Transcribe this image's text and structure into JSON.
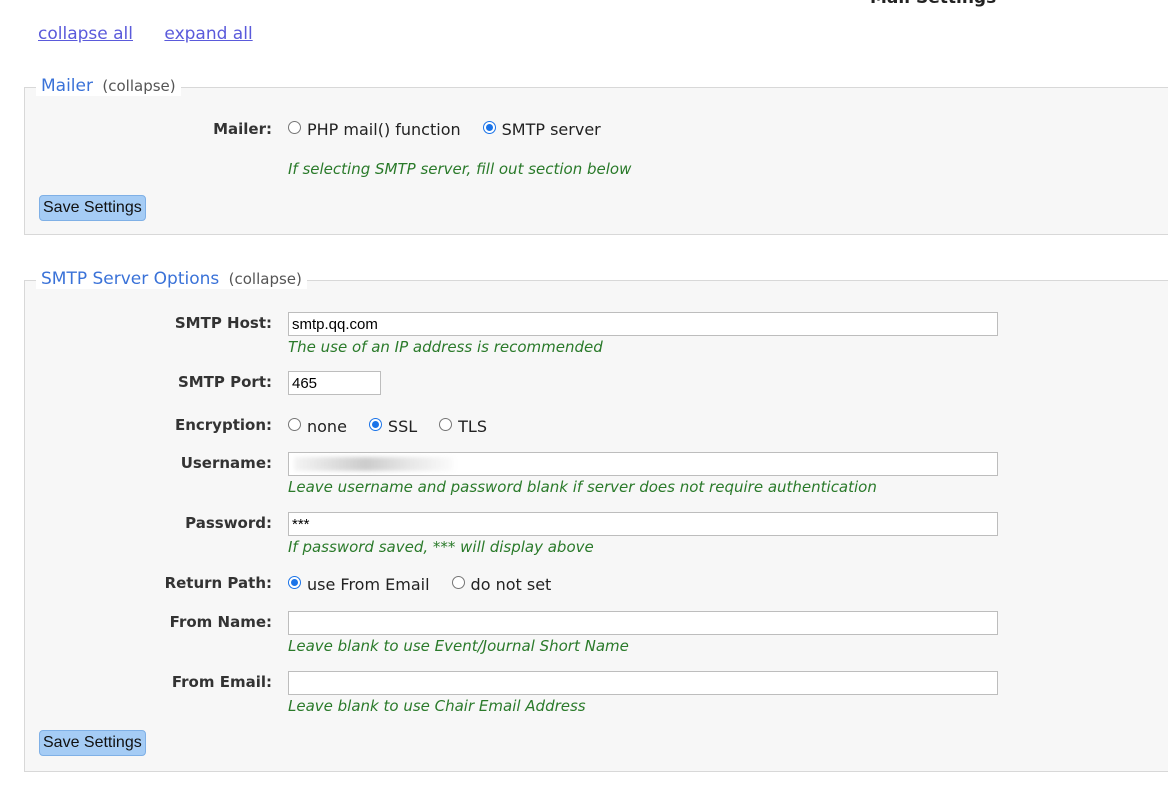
{
  "header": {
    "title": "Mail Settings"
  },
  "toplinks": {
    "collapse_all": "collapse all",
    "expand_all": "expand all"
  },
  "mailer": {
    "legend": "Mailer",
    "collapse": "(collapse)",
    "label": "Mailer:",
    "options": [
      "PHP mail() function",
      "SMTP server"
    ],
    "selected": "SMTP server",
    "hint": "If selecting SMTP server, fill out section below",
    "save_label": "Save Settings"
  },
  "smtp": {
    "legend": "SMTP Server Options",
    "collapse": "(collapse)",
    "host": {
      "label": "SMTP Host:",
      "value": "smtp.qq.com",
      "hint": "The use of an IP address is recommended"
    },
    "port": {
      "label": "SMTP Port:",
      "value": "465"
    },
    "encryption": {
      "label": "Encryption:",
      "options": [
        "none",
        "SSL",
        "TLS"
      ],
      "selected": "SSL"
    },
    "username": {
      "label": "Username:",
      "value": "",
      "hint": "Leave username and password blank if server does not require authentication"
    },
    "password": {
      "label": "Password:",
      "value": "***",
      "hint": "If password saved, *** will display above"
    },
    "return_path": {
      "label": "Return Path:",
      "options": [
        "use From Email",
        "do not set"
      ],
      "selected": "use From Email"
    },
    "from_name": {
      "label": "From Name:",
      "value": "",
      "hint": "Leave blank to use Event/Journal Short Name"
    },
    "from_email": {
      "label": "From Email:",
      "value": "",
      "hint": "Leave blank to use Chair Email Address"
    },
    "save_label": "Save Settings"
  }
}
